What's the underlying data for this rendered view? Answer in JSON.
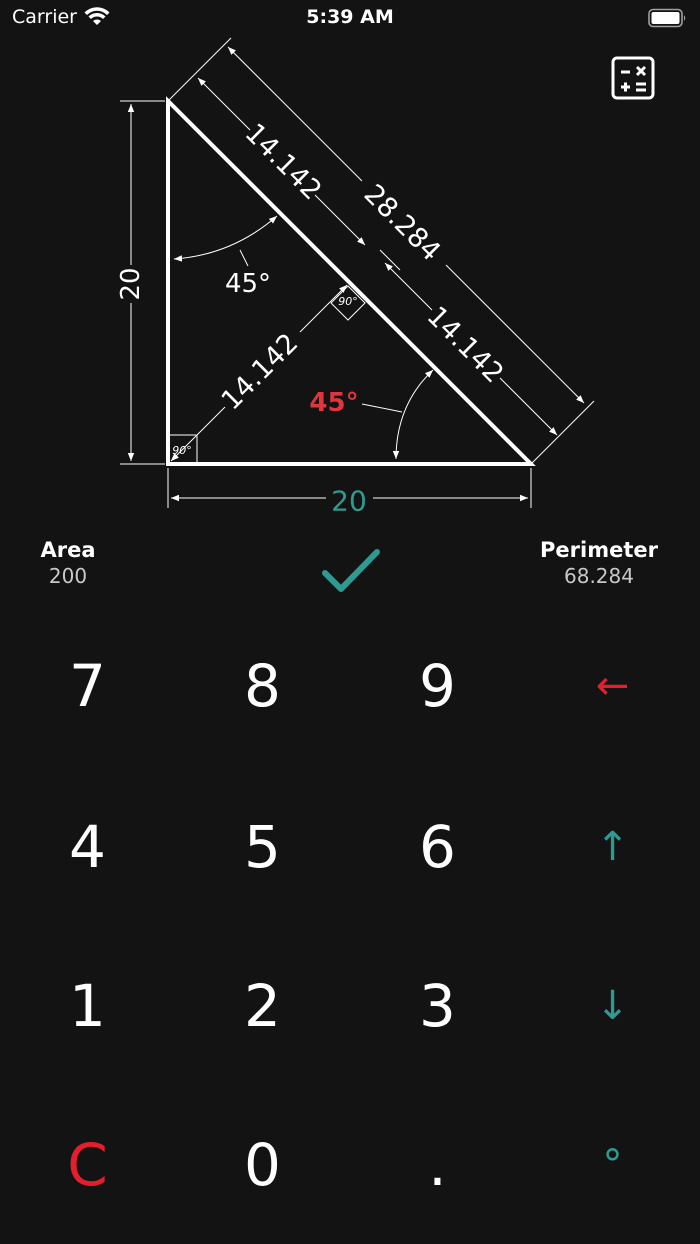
{
  "status": {
    "carrier": "Carrier",
    "time": "5:39 AM"
  },
  "toolbar": {
    "calculator_icon": "calculator-icon"
  },
  "diagram": {
    "left_side": "20",
    "bottom_side": "20",
    "hypotenuse": "28.284",
    "hyp_segment_upper": "14.142",
    "hyp_segment_lower": "14.142",
    "altitude": "14.142",
    "top_angle": "45°",
    "bottom_angle": "45°",
    "right_angle_small": "90°",
    "right_angle_altitude": "90°",
    "colors": {
      "line": "#ffffff",
      "accent_red": "#e0353b",
      "accent_teal": "#2f9a92"
    }
  },
  "summary": {
    "area_label": "Area",
    "area_value": "200",
    "perimeter_label": "Perimeter",
    "perimeter_value": "68.284"
  },
  "keypad": {
    "k7": "7",
    "k8": "8",
    "k9": "9",
    "backspace": "←",
    "k4": "4",
    "k5": "5",
    "k6": "6",
    "up": "↑",
    "k1": "1",
    "k2": "2",
    "k3": "3",
    "down": "↓",
    "clear": "C",
    "k0": "0",
    "dot": ".",
    "degree": "°"
  }
}
